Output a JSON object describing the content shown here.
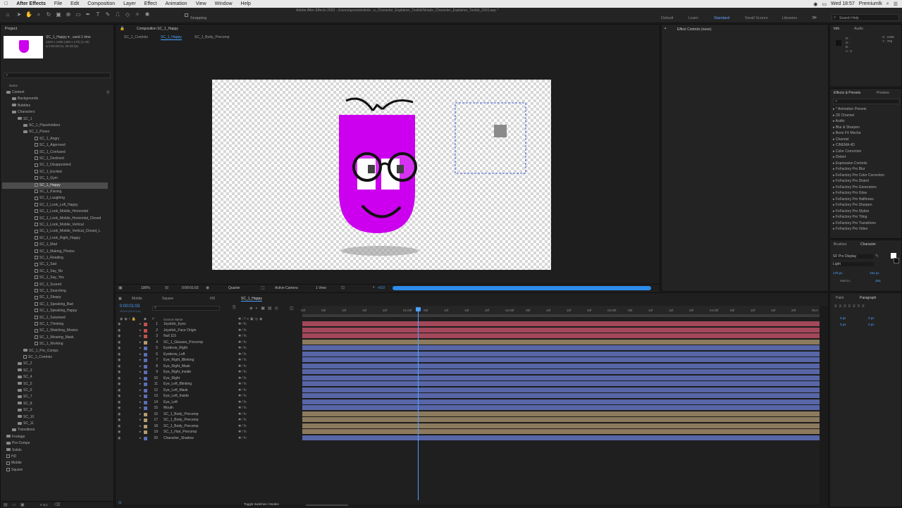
{
  "menubar": {
    "app": "After Effects",
    "items": [
      "File",
      "Edit",
      "Composition",
      "Layer",
      "Effect",
      "Animation",
      "View",
      "Window",
      "Help"
    ],
    "clock": "Wed 18:57",
    "user": "Premiumlk"
  },
  "window_title": "Adobe After Effects 2020 - /Users/apostolsokolo...e_Character_Explainer_Toolkit/Simple_Character_Explainer_Toolkit_2020.aep *",
  "toolbar": {
    "snapping": "Snapping",
    "workspaces": [
      "Default",
      "Learn",
      "Standard",
      "Small Screen",
      "Libraries"
    ],
    "active_workspace": "Standard",
    "search_help": "Search Help"
  },
  "project": {
    "title": "Project",
    "item_name": "SC_1_Happy ▾ , used 1 time",
    "item_info1": "1920 x 1080 (480 x 270) (1.00)",
    "item_info2": "Δ 0:00:05:01, 25.00 fps",
    "col_name": "Name",
    "tree": [
      {
        "label": "Content",
        "indent": 0,
        "type": "folder"
      },
      {
        "label": "Backgrounds",
        "indent": 1,
        "type": "folder"
      },
      {
        "label": "Bubbles",
        "indent": 1,
        "type": "folder"
      },
      {
        "label": "Characters",
        "indent": 1,
        "type": "folder"
      },
      {
        "label": "SC_1",
        "indent": 2,
        "type": "folder"
      },
      {
        "label": "SC_1_Placeholders",
        "indent": 3,
        "type": "folder"
      },
      {
        "label": "SC_1_Poses",
        "indent": 3,
        "type": "folder"
      },
      {
        "label": "SC_1_Angry",
        "indent": 4,
        "type": "comp"
      },
      {
        "label": "SC_1_Approved",
        "indent": 4,
        "type": "comp"
      },
      {
        "label": "SC_1_Confused",
        "indent": 4,
        "type": "comp"
      },
      {
        "label": "SC_1_Declined",
        "indent": 4,
        "type": "comp"
      },
      {
        "label": "SC_1_Disappointed",
        "indent": 4,
        "type": "comp"
      },
      {
        "label": "SC_1_Excited",
        "indent": 4,
        "type": "comp"
      },
      {
        "label": "SC_1_Gym",
        "indent": 4,
        "type": "comp"
      },
      {
        "label": "SC_1_Happy",
        "indent": 4,
        "type": "comp",
        "selected": true
      },
      {
        "label": "SC_1_Kissing",
        "indent": 4,
        "type": "comp"
      },
      {
        "label": "SC_1_Laughing",
        "indent": 4,
        "type": "comp"
      },
      {
        "label": "SC_1_Look_Left_Happy",
        "indent": 4,
        "type": "comp"
      },
      {
        "label": "SC_1_Look_Mobile_Horizontal",
        "indent": 4,
        "type": "comp"
      },
      {
        "label": "SC_1_Look_Mobile_Horizontal_Closed",
        "indent": 4,
        "type": "comp"
      },
      {
        "label": "SC_1_Look_Mobile_Vertical",
        "indent": 4,
        "type": "comp"
      },
      {
        "label": "SC_1_Look_Mobile_Vertical_Closed_L",
        "indent": 4,
        "type": "comp"
      },
      {
        "label": "SC_1_Look_Right_Happy",
        "indent": 4,
        "type": "comp"
      },
      {
        "label": "SC_1_Mad",
        "indent": 4,
        "type": "comp"
      },
      {
        "label": "SC_1_Making_Photos",
        "indent": 4,
        "type": "comp"
      },
      {
        "label": "SC_1_Reading",
        "indent": 4,
        "type": "comp"
      },
      {
        "label": "SC_1_Sad",
        "indent": 4,
        "type": "comp"
      },
      {
        "label": "SC_1_Say_No",
        "indent": 4,
        "type": "comp"
      },
      {
        "label": "SC_1_Say_Yes",
        "indent": 4,
        "type": "comp"
      },
      {
        "label": "SC_1_Scared",
        "indent": 4,
        "type": "comp"
      },
      {
        "label": "SC_1_Searching",
        "indent": 4,
        "type": "comp"
      },
      {
        "label": "SC_1_Sleepy",
        "indent": 4,
        "type": "comp"
      },
      {
        "label": "SC_1_Speaking_Bad",
        "indent": 4,
        "type": "comp"
      },
      {
        "label": "SC_1_Speaking_Happy",
        "indent": 4,
        "type": "comp"
      },
      {
        "label": "SC_1_Surprised",
        "indent": 4,
        "type": "comp"
      },
      {
        "label": "SC_1_Thinking",
        "indent": 4,
        "type": "comp"
      },
      {
        "label": "SC_1_Watching_Movies",
        "indent": 4,
        "type": "comp"
      },
      {
        "label": "SC_1_Wearing_Mask",
        "indent": 4,
        "type": "comp"
      },
      {
        "label": "SC_1_Working",
        "indent": 4,
        "type": "comp"
      },
      {
        "label": "SC_1_Pre_Comps",
        "indent": 3,
        "type": "folder"
      },
      {
        "label": "SC_1_Controls",
        "indent": 3,
        "type": "comp"
      },
      {
        "label": "SC_2",
        "indent": 2,
        "type": "folder"
      },
      {
        "label": "SC_3",
        "indent": 2,
        "type": "folder"
      },
      {
        "label": "SC_4",
        "indent": 2,
        "type": "folder"
      },
      {
        "label": "SC_5",
        "indent": 2,
        "type": "folder"
      },
      {
        "label": "SC_6",
        "indent": 2,
        "type": "folder"
      },
      {
        "label": "SC_7",
        "indent": 2,
        "type": "folder"
      },
      {
        "label": "SC_8",
        "indent": 2,
        "type": "folder"
      },
      {
        "label": "SC_9",
        "indent": 2,
        "type": "folder"
      },
      {
        "label": "SC_10",
        "indent": 2,
        "type": "folder"
      },
      {
        "label": "SC_11",
        "indent": 2,
        "type": "folder"
      },
      {
        "label": "Transitions",
        "indent": 1,
        "type": "folder"
      },
      {
        "label": "Footage",
        "indent": 0,
        "type": "folder"
      },
      {
        "label": "Pre-Comps",
        "indent": 0,
        "type": "folder"
      },
      {
        "label": "Solids",
        "indent": 0,
        "type": "folder"
      },
      {
        "label": "HD",
        "indent": 0,
        "type": "comp"
      },
      {
        "label": "Mobile",
        "indent": 0,
        "type": "comp"
      },
      {
        "label": "Square",
        "indent": 0,
        "type": "comp"
      }
    ],
    "bottom": "8 bpc"
  },
  "composition": {
    "title": "Composition SC_1_Happy",
    "breadcrumbs": [
      "SC_1_Controls",
      "SC_1_Happy",
      "SC_1_Body_Precomp"
    ],
    "footer": {
      "zoom": "100%",
      "timecode": "0:00:01:03",
      "quality": "Quarter",
      "view": "Active Camera",
      "views": "1 View",
      "exposure": "+0.0"
    }
  },
  "effect_controls": {
    "title": "Effect Controls (none)"
  },
  "info": {
    "tabs": [
      "Info",
      "Audio"
    ],
    "readout": [
      "R :",
      "G :",
      "B :",
      "A : 0"
    ],
    "coords": [
      "X : 2498",
      "Y : 758"
    ]
  },
  "effects": {
    "tabs": [
      "Effects & Presets",
      "Preview"
    ],
    "items": [
      "* Animation Presets",
      "3D Channel",
      "Audio",
      "Blur & Sharpen",
      "Boris FX Mocha",
      "Channel",
      "CINEMA 4D",
      "Color Correction",
      "Distort",
      "Expression Controls",
      "FxFactory Pro Blur",
      "FxFactory Pro Color Correction",
      "FxFactory Pro Distort",
      "FxFactory Pro Generators",
      "FxFactory Pro Glow",
      "FxFactory Pro Halftones",
      "FxFactory Pro Sharpen",
      "FxFactory Pro Stylize",
      "FxFactory Pro Tiling",
      "FxFactory Pro Transitions",
      "FxFactory Pro Video"
    ]
  },
  "character": {
    "tabs": [
      "Brushes",
      "Character"
    ],
    "font": "SF Pro Display",
    "style": "Light",
    "size": "175 px",
    "leading": "154 px",
    "tracking": "Metrics",
    "tsume": "283"
  },
  "paragraph": {
    "tabs": [
      "Paint",
      "Paragraph"
    ],
    "indent1": "0 px",
    "indent2": "0 px",
    "space1": "0 px",
    "space2": "0 px"
  },
  "timeline": {
    "tabs": [
      "Mobile",
      "Square",
      "HD",
      "SC_1_Happy"
    ],
    "timecode": "0:00:01:03",
    "frames": "00028 (25.00 fps)",
    "source_name": "Source Name",
    "ticks": [
      "00f",
      "05f",
      "10f",
      "15f",
      "20f",
      "01:00f",
      "05f",
      "10f",
      "15f",
      "20f",
      "02:00f",
      "05f",
      "10f",
      "15f",
      "20f",
      "03:00f",
      "05f",
      "10f",
      "15f",
      "20f",
      "04:00f",
      "05f",
      "10f",
      "15f",
      "20f",
      "05:0"
    ],
    "layers": [
      {
        "n": "1",
        "name": "Joystick_Eyes",
        "color": "#c24f4f",
        "bar": "#a3475a"
      },
      {
        "n": "2",
        "name": "Joystick_Face Origin",
        "color": "#c24f4f",
        "bar": "#a3475a"
      },
      {
        "n": "3",
        "name": "Null 115",
        "color": "#c24f4f",
        "bar": "#a3475a"
      },
      {
        "n": "4",
        "name": "SC_1_Glasses_Precomp",
        "color": "#b49a70",
        "bar": "#8c7a5e"
      },
      {
        "n": "5",
        "name": "Eyebrow_Right",
        "color": "#5b6db8",
        "bar": "#5866a8"
      },
      {
        "n": "6",
        "name": "Eyebrow_Left",
        "color": "#5b6db8",
        "bar": "#5866a8"
      },
      {
        "n": "7",
        "name": "Eye_Right_Blinking",
        "color": "#5b6db8",
        "bar": "#5866a8"
      },
      {
        "n": "8",
        "name": "Eye_Right_Mask",
        "color": "#5b6db8",
        "bar": "#5866a8"
      },
      {
        "n": "9",
        "name": "Eye_Right_Inside",
        "color": "#5b6db8",
        "bar": "#5866a8"
      },
      {
        "n": "10",
        "name": "Eye_Right",
        "color": "#5b6db8",
        "bar": "#5866a8"
      },
      {
        "n": "11",
        "name": "Eye_Left_Blinking",
        "color": "#5b6db8",
        "bar": "#5866a8"
      },
      {
        "n": "12",
        "name": "Eye_Left_Mask",
        "color": "#5b6db8",
        "bar": "#5866a8"
      },
      {
        "n": "13",
        "name": "Eye_Left_Inside",
        "color": "#5b6db8",
        "bar": "#5866a8"
      },
      {
        "n": "14",
        "name": "Eye_Left",
        "color": "#5b6db8",
        "bar": "#5866a8"
      },
      {
        "n": "15",
        "name": "Mouth",
        "color": "#5b6db8",
        "bar": "#5866a8"
      },
      {
        "n": "16",
        "name": "SC_1_Body_Precomp",
        "color": "#b49a70",
        "bar": "#8c7a5e"
      },
      {
        "n": "17",
        "name": "SC_1_Body_Precomp",
        "color": "#b49a70",
        "bar": "#8c7a5e"
      },
      {
        "n": "18",
        "name": "SC_1_Body_Precomp",
        "color": "#b49a70",
        "bar": "#8c7a5e"
      },
      {
        "n": "19",
        "name": "SC_1_Hair_Precomp",
        "color": "#b49a70",
        "bar": "#8c7a5e"
      },
      {
        "n": "20",
        "name": "Character_Shadow",
        "color": "#5b6db8",
        "bar": "#5866a8"
      }
    ],
    "toggle": "Toggle Switches / Modes"
  },
  "colors": {
    "accent": "#2d8ceb",
    "character_purple": "#cc00ee",
    "bg_panel": "#232323"
  }
}
